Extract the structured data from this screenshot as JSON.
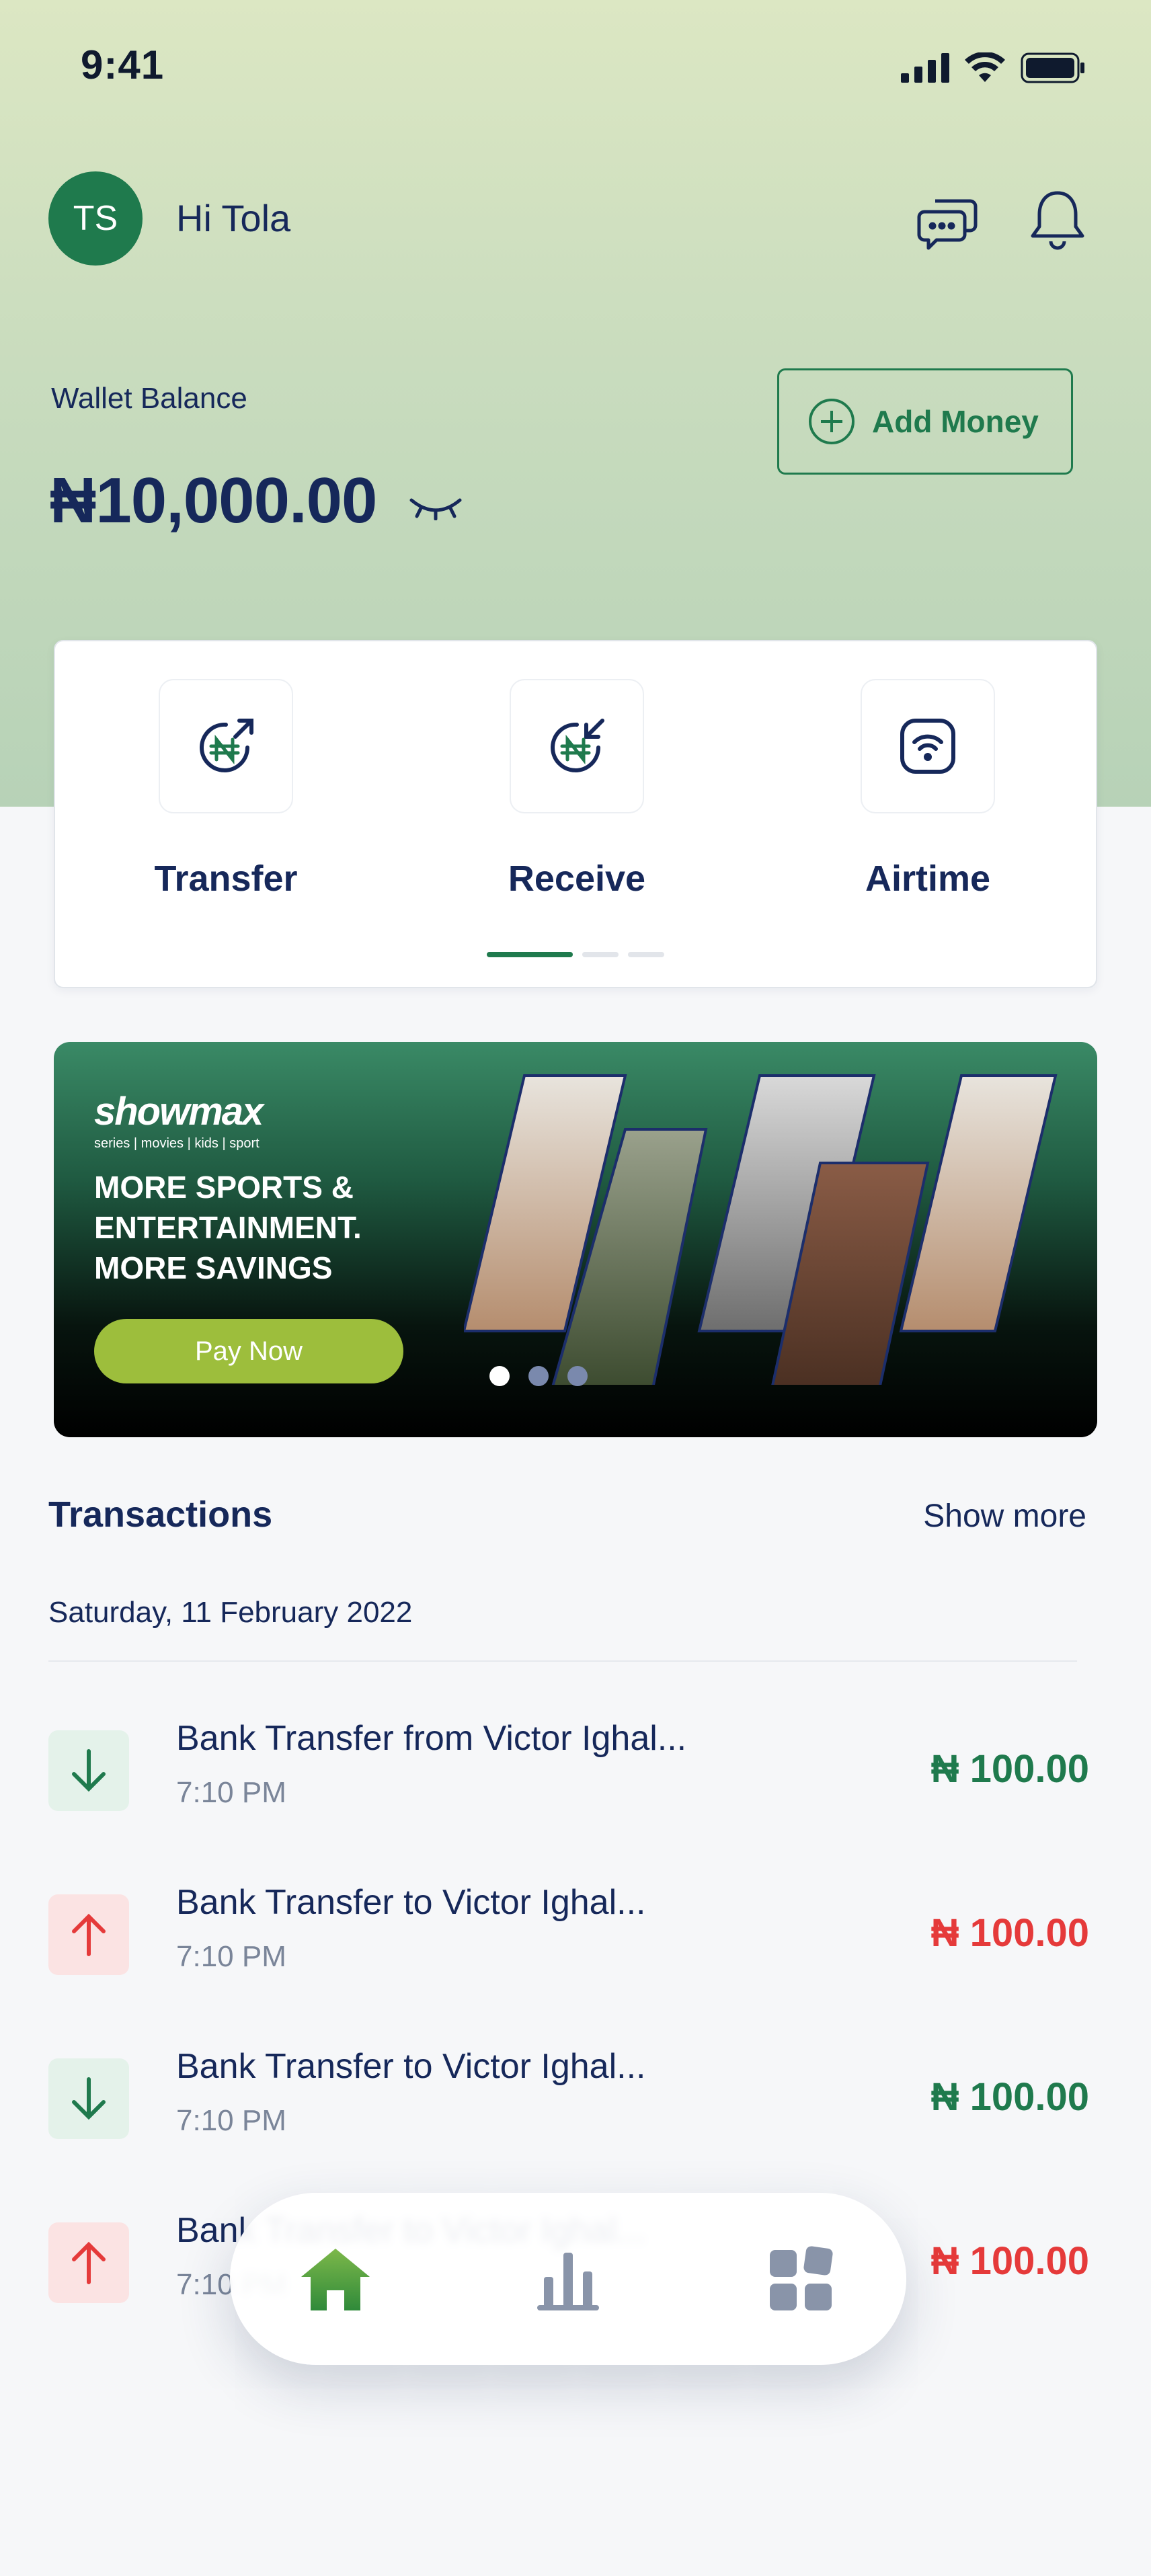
{
  "status_bar": {
    "time": "9:41"
  },
  "header": {
    "avatar_initials": "TS",
    "greeting": "Hi Tola",
    "chat_icon": "chat-bubbles-icon",
    "notification_icon": "bell-icon"
  },
  "wallet": {
    "label": "Wallet Balance",
    "amount": "₦10,000.00",
    "toggle_icon": "eye-closed-icon",
    "add_money_label": "Add Money"
  },
  "actions": [
    {
      "label": "Transfer",
      "icon": "naira-send-icon"
    },
    {
      "label": "Receive",
      "icon": "naira-receive-icon"
    },
    {
      "label": "Airtime",
      "icon": "phone-signal-icon"
    }
  ],
  "actions_pager": {
    "active_index": 0,
    "count": 3
  },
  "banner": {
    "brand": "showmax",
    "brand_tagline": "series | movies | kids | sport",
    "headline": "MORE SPORTS & ENTERTAINMENT. MORE SAVINGS",
    "cta": "Pay Now",
    "active_slide": 0,
    "slide_count": 3
  },
  "transactions": {
    "title": "Transactions",
    "show_more": "Show more",
    "date_heading": "Saturday, 11 February 2022",
    "items": [
      {
        "name": "Bank Transfer from Victor Ighal...",
        "time": "7:10 PM",
        "amount": "₦ 100.00",
        "direction": "in"
      },
      {
        "name": "Bank Transfer to Victor Ighal...",
        "time": "7:10 PM",
        "amount": "₦ 100.00",
        "direction": "out"
      },
      {
        "name": "Bank Transfer to Victor Ighal...",
        "time": "7:10 PM",
        "amount": "₦ 100.00",
        "direction": "in"
      },
      {
        "name": "Bank Transfer to Victor Ighal...",
        "time": "7:10 PM",
        "amount": "₦ 100.00",
        "direction": "out"
      }
    ]
  },
  "bottom_nav": [
    {
      "icon": "home-icon",
      "active": true
    },
    {
      "icon": "bar-chart-icon",
      "active": false
    },
    {
      "icon": "grid-icon",
      "active": false
    }
  ],
  "colors": {
    "primary": "#1F7A4D",
    "navy": "#16285A",
    "incoming": "#1F7A4D",
    "outgoing": "#E53A3A",
    "cta": "#9DBE3C"
  }
}
